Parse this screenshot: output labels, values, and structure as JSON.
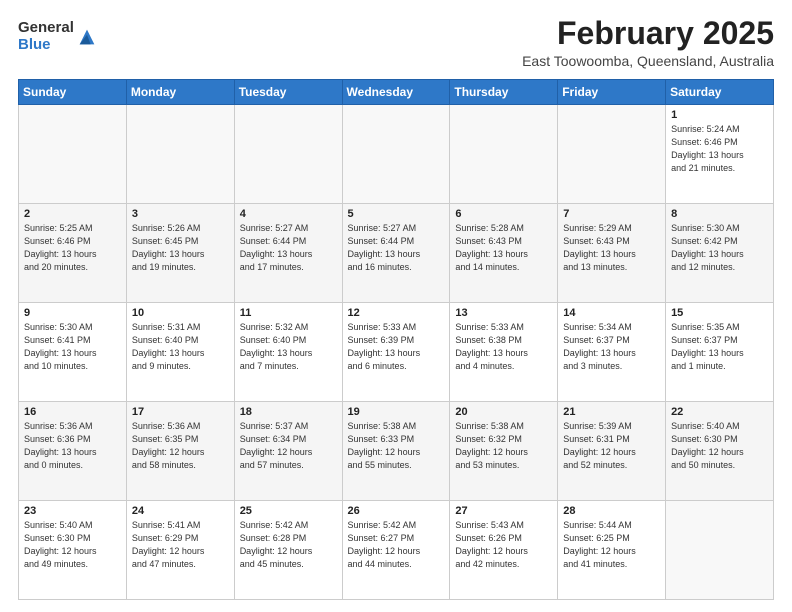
{
  "header": {
    "logo_general": "General",
    "logo_blue": "Blue",
    "month_title": "February 2025",
    "subtitle": "East Toowoomba, Queensland, Australia"
  },
  "weekdays": [
    "Sunday",
    "Monday",
    "Tuesday",
    "Wednesday",
    "Thursday",
    "Friday",
    "Saturday"
  ],
  "weeks": [
    [
      {
        "day": "",
        "info": ""
      },
      {
        "day": "",
        "info": ""
      },
      {
        "day": "",
        "info": ""
      },
      {
        "day": "",
        "info": ""
      },
      {
        "day": "",
        "info": ""
      },
      {
        "day": "",
        "info": ""
      },
      {
        "day": "1",
        "info": "Sunrise: 5:24 AM\nSunset: 6:46 PM\nDaylight: 13 hours\nand 21 minutes."
      }
    ],
    [
      {
        "day": "2",
        "info": "Sunrise: 5:25 AM\nSunset: 6:46 PM\nDaylight: 13 hours\nand 20 minutes."
      },
      {
        "day": "3",
        "info": "Sunrise: 5:26 AM\nSunset: 6:45 PM\nDaylight: 13 hours\nand 19 minutes."
      },
      {
        "day": "4",
        "info": "Sunrise: 5:27 AM\nSunset: 6:44 PM\nDaylight: 13 hours\nand 17 minutes."
      },
      {
        "day": "5",
        "info": "Sunrise: 5:27 AM\nSunset: 6:44 PM\nDaylight: 13 hours\nand 16 minutes."
      },
      {
        "day": "6",
        "info": "Sunrise: 5:28 AM\nSunset: 6:43 PM\nDaylight: 13 hours\nand 14 minutes."
      },
      {
        "day": "7",
        "info": "Sunrise: 5:29 AM\nSunset: 6:43 PM\nDaylight: 13 hours\nand 13 minutes."
      },
      {
        "day": "8",
        "info": "Sunrise: 5:30 AM\nSunset: 6:42 PM\nDaylight: 13 hours\nand 12 minutes."
      }
    ],
    [
      {
        "day": "9",
        "info": "Sunrise: 5:30 AM\nSunset: 6:41 PM\nDaylight: 13 hours\nand 10 minutes."
      },
      {
        "day": "10",
        "info": "Sunrise: 5:31 AM\nSunset: 6:40 PM\nDaylight: 13 hours\nand 9 minutes."
      },
      {
        "day": "11",
        "info": "Sunrise: 5:32 AM\nSunset: 6:40 PM\nDaylight: 13 hours\nand 7 minutes."
      },
      {
        "day": "12",
        "info": "Sunrise: 5:33 AM\nSunset: 6:39 PM\nDaylight: 13 hours\nand 6 minutes."
      },
      {
        "day": "13",
        "info": "Sunrise: 5:33 AM\nSunset: 6:38 PM\nDaylight: 13 hours\nand 4 minutes."
      },
      {
        "day": "14",
        "info": "Sunrise: 5:34 AM\nSunset: 6:37 PM\nDaylight: 13 hours\nand 3 minutes."
      },
      {
        "day": "15",
        "info": "Sunrise: 5:35 AM\nSunset: 6:37 PM\nDaylight: 13 hours\nand 1 minute."
      }
    ],
    [
      {
        "day": "16",
        "info": "Sunrise: 5:36 AM\nSunset: 6:36 PM\nDaylight: 13 hours\nand 0 minutes."
      },
      {
        "day": "17",
        "info": "Sunrise: 5:36 AM\nSunset: 6:35 PM\nDaylight: 12 hours\nand 58 minutes."
      },
      {
        "day": "18",
        "info": "Sunrise: 5:37 AM\nSunset: 6:34 PM\nDaylight: 12 hours\nand 57 minutes."
      },
      {
        "day": "19",
        "info": "Sunrise: 5:38 AM\nSunset: 6:33 PM\nDaylight: 12 hours\nand 55 minutes."
      },
      {
        "day": "20",
        "info": "Sunrise: 5:38 AM\nSunset: 6:32 PM\nDaylight: 12 hours\nand 53 minutes."
      },
      {
        "day": "21",
        "info": "Sunrise: 5:39 AM\nSunset: 6:31 PM\nDaylight: 12 hours\nand 52 minutes."
      },
      {
        "day": "22",
        "info": "Sunrise: 5:40 AM\nSunset: 6:30 PM\nDaylight: 12 hours\nand 50 minutes."
      }
    ],
    [
      {
        "day": "23",
        "info": "Sunrise: 5:40 AM\nSunset: 6:30 PM\nDaylight: 12 hours\nand 49 minutes."
      },
      {
        "day": "24",
        "info": "Sunrise: 5:41 AM\nSunset: 6:29 PM\nDaylight: 12 hours\nand 47 minutes."
      },
      {
        "day": "25",
        "info": "Sunrise: 5:42 AM\nSunset: 6:28 PM\nDaylight: 12 hours\nand 45 minutes."
      },
      {
        "day": "26",
        "info": "Sunrise: 5:42 AM\nSunset: 6:27 PM\nDaylight: 12 hours\nand 44 minutes."
      },
      {
        "day": "27",
        "info": "Sunrise: 5:43 AM\nSunset: 6:26 PM\nDaylight: 12 hours\nand 42 minutes."
      },
      {
        "day": "28",
        "info": "Sunrise: 5:44 AM\nSunset: 6:25 PM\nDaylight: 12 hours\nand 41 minutes."
      },
      {
        "day": "",
        "info": ""
      }
    ]
  ]
}
